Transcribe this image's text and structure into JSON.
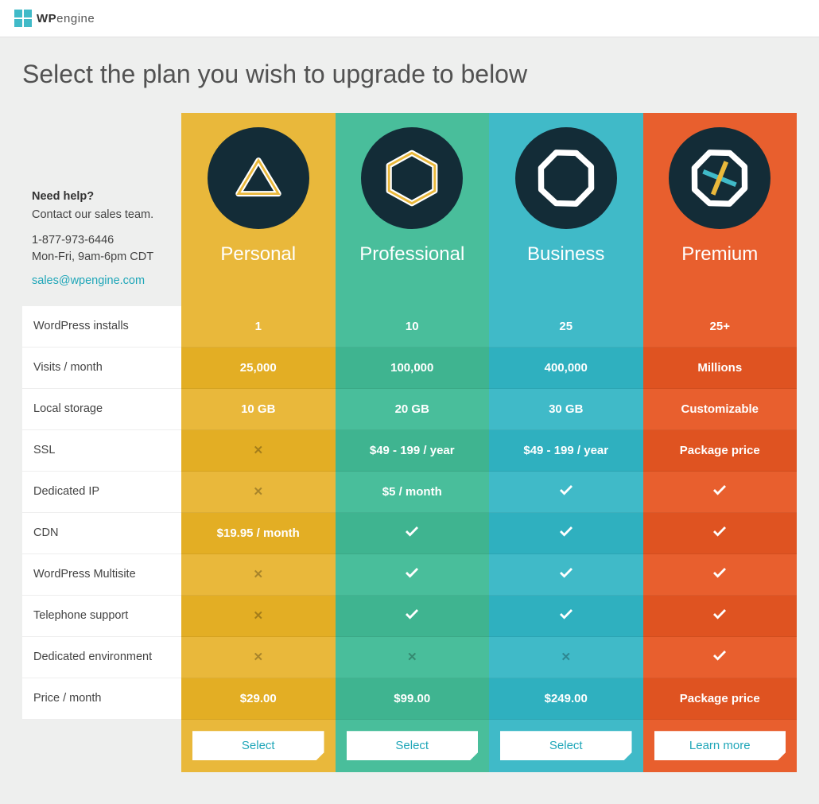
{
  "brand": {
    "name_light": "WP",
    "name_bold": "engine"
  },
  "page_title": "Select the plan you wish to upgrade to below",
  "help": {
    "heading": "Need help?",
    "subheading": "Contact our sales team.",
    "phone": "1-877-973-6446",
    "hours": "Mon-Fri, 9am-6pm CDT",
    "email": "sales@wpengine.com"
  },
  "features": [
    "WordPress installs",
    "Visits / month",
    "Local storage",
    "SSL",
    "Dedicated IP",
    "CDN",
    "WordPress Multisite",
    "Telephone support",
    "Dedicated environment",
    "Price / month"
  ],
  "plans": [
    {
      "key": "personal",
      "name": "Personal",
      "color": "#e9b83b",
      "cta": "Select",
      "values": [
        "1",
        "25,000",
        "10 GB",
        "__x",
        "__x",
        "$19.95 / month",
        "__x",
        "__x",
        "__x",
        "$29.00"
      ]
    },
    {
      "key": "professional",
      "name": "Professional",
      "color": "#49be9b",
      "cta": "Select",
      "values": [
        "10",
        "100,000",
        "20 GB",
        "$49 - 199 / year",
        "$5 / month",
        "__check",
        "__check",
        "__check",
        "__x",
        "$99.00"
      ]
    },
    {
      "key": "business",
      "name": "Business",
      "color": "#40bac8",
      "cta": "Select",
      "values": [
        "25",
        "400,000",
        "30 GB",
        "$49 - 199 / year",
        "__check",
        "__check",
        "__check",
        "__check",
        "__x",
        "$249.00"
      ]
    },
    {
      "key": "premium",
      "name": "Premium",
      "color": "#e85f2e",
      "cta": "Learn more",
      "values": [
        "25+",
        "Millions",
        "Customizable",
        "Package price",
        "__check",
        "__check",
        "__check",
        "__check",
        "__check",
        "Package price"
      ]
    }
  ]
}
